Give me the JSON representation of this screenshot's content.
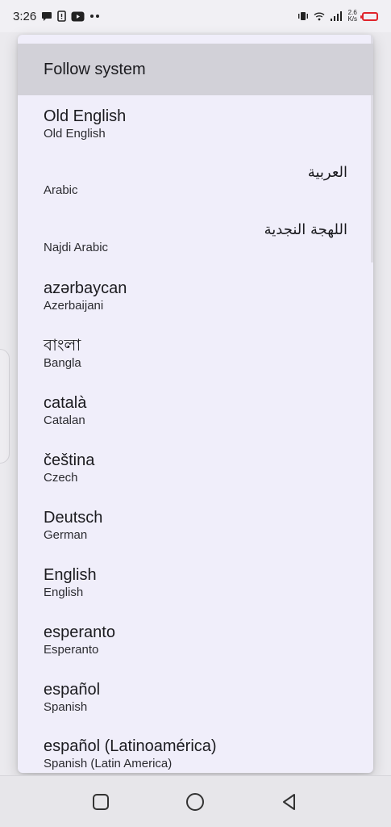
{
  "status_bar": {
    "time": "3:26",
    "net_speed_value": "2.6",
    "net_speed_unit": "K/s",
    "left_icons": [
      "chat-bubble-icon",
      "sim-alert-icon",
      "youtube-icon",
      "more-dots-icon"
    ],
    "right_icons": [
      "vibrate-icon",
      "wifi-icon",
      "signal-icon",
      "battery-low-icon"
    ],
    "battery_color": "#e0242b"
  },
  "dialog": {
    "options": [
      {
        "title": "Follow system",
        "subtitle": "",
        "selected": true
      },
      {
        "title": "Old English",
        "subtitle": "Old English"
      },
      {
        "title": "العربية",
        "subtitle": "Arabic",
        "rtl": true
      },
      {
        "title": "اللهجة النجدية",
        "subtitle": "Najdi Arabic",
        "rtl": true
      },
      {
        "title": "azərbaycan",
        "subtitle": "Azerbaijani"
      },
      {
        "title": "বাংলা",
        "subtitle": "Bangla"
      },
      {
        "title": "català",
        "subtitle": "Catalan"
      },
      {
        "title": "čeština",
        "subtitle": "Czech"
      },
      {
        "title": "Deutsch",
        "subtitle": "German"
      },
      {
        "title": "English",
        "subtitle": "English"
      },
      {
        "title": "esperanto",
        "subtitle": "Esperanto"
      },
      {
        "title": "español",
        "subtitle": "Spanish"
      },
      {
        "title": "español (Latinoamérica)",
        "subtitle": "Spanish (Latin America)"
      }
    ]
  },
  "nav_bar": {
    "buttons": [
      "recents-square-icon",
      "home-circle-icon",
      "back-triangle-icon"
    ]
  }
}
